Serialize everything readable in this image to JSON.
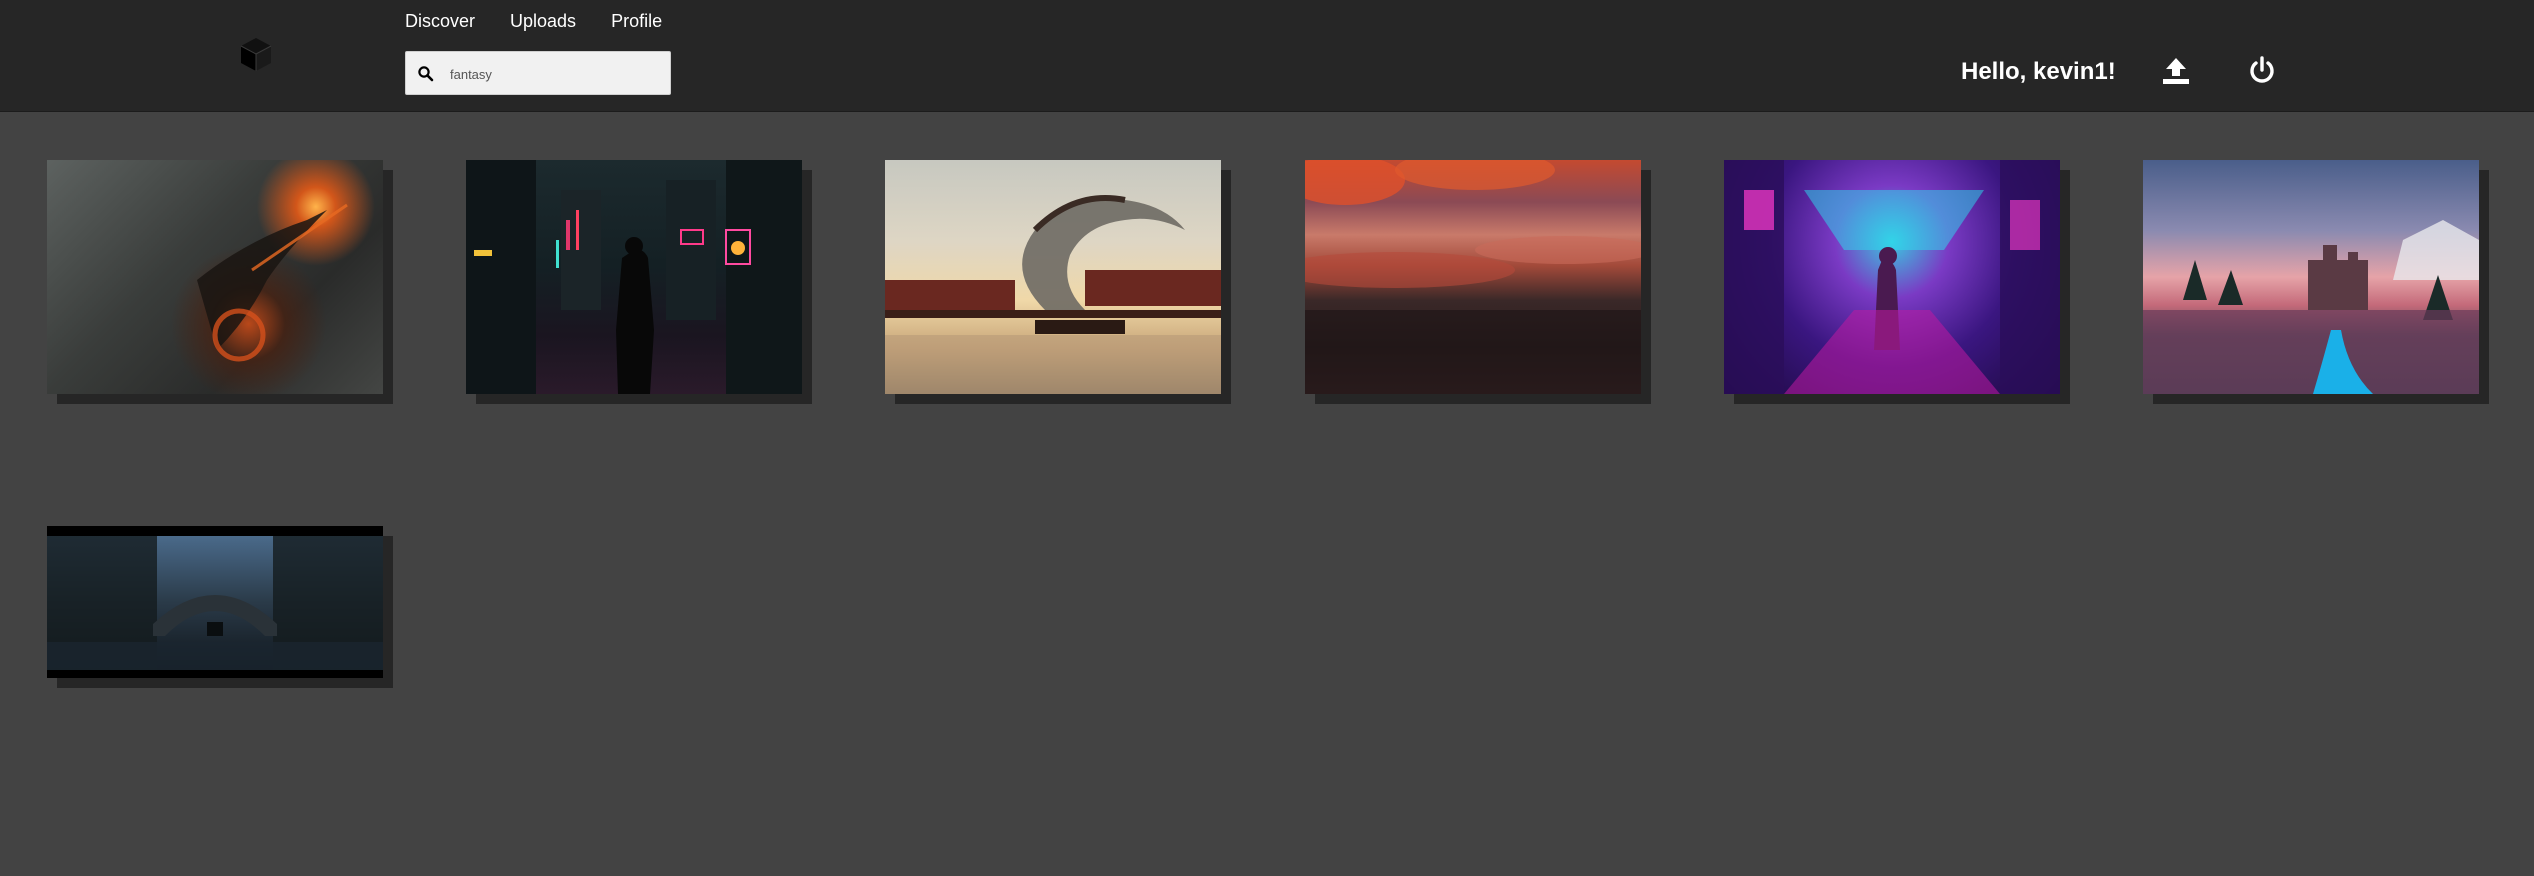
{
  "nav": {
    "items": [
      {
        "label": "Discover"
      },
      {
        "label": "Uploads"
      },
      {
        "label": "Profile"
      }
    ]
  },
  "search": {
    "value": "fantasy",
    "icon": "search-icon"
  },
  "header": {
    "greeting": "Hello, kevin1!",
    "upload_icon": "upload-icon",
    "power_icon": "power-icon",
    "logo_icon": "cube-icon"
  },
  "gallery": {
    "images": [
      {
        "subject": "dark fantasy creature with fiery orb in smoke"
      },
      {
        "subject": "figure in neon cyberpunk city street"
      },
      {
        "subject": "wave-shaped dragon over water palace"
      },
      {
        "subject": "sunset clouds over reflective water"
      },
      {
        "subject": "figure in purple neon sci-fi corridor"
      },
      {
        "subject": "castle with pine trees and blue stream"
      },
      {
        "subject": "boat under stone bridge in dark forest"
      }
    ]
  }
}
